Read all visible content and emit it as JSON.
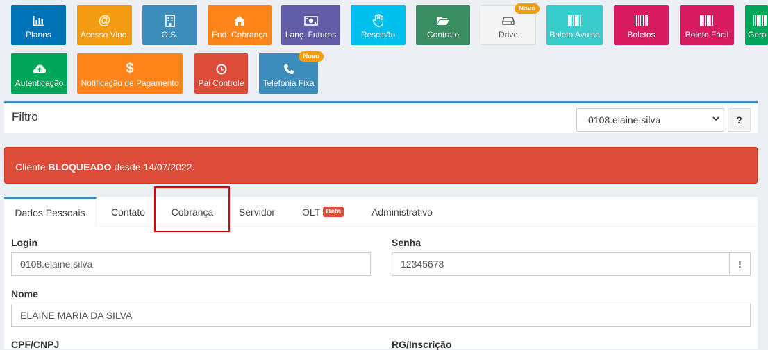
{
  "toolbar": {
    "planos": "Planos",
    "acesso_vinc": "Acesso Vinc.",
    "os": "O.S.",
    "end_cobranca": "End. Cobrança",
    "lanc_futuros": "Lanç. Futuros",
    "rescisao": "Rescisão",
    "contrato": "Contrato",
    "drive": "Drive",
    "boleto_avulso": "Boleto Avulso",
    "boletos": "Boletos",
    "boleto_facil": "Boleto Fácil",
    "gera": "Gera",
    "autenticacao": "Autenticação",
    "notificacao": "Notificação de Pagamento",
    "pai_controle": "Pai Controle",
    "telefonia_fixa": "Telefonia Fixa",
    "novo_badge": "Novo"
  },
  "colors": {
    "planos": "#0073b7",
    "acesso_vinc": "#f39c12",
    "os": "#3c8dbc",
    "end_cobranca": "#ff851b",
    "lanc_futuros": "#605ca8",
    "rescisao": "#00c0ef",
    "contrato": "#398d61",
    "drive": "#f4f4f4",
    "boleto_avulso": "#39cccc",
    "boletos": "#d81b60",
    "boleto_facil": "#d81b60",
    "gera": "#00a65a",
    "autenticacao": "#00a65a",
    "notificacao": "#ff851b",
    "pai_controle": "#dd4b39",
    "telefonia_fixa": "#3c8dbc",
    "alert": "#dd4b39",
    "accent": "#3c8dbc"
  },
  "icons": {
    "planos": "bar-chart-icon",
    "acesso_vinc": "at-icon",
    "os": "building-icon",
    "end_cobranca": "home-icon",
    "lanc_futuros": "money-icon",
    "rescisao": "hand-icon",
    "contrato": "folder-open-icon",
    "drive": "hard-drive-icon",
    "boleto": "barcode-icon",
    "autenticacao": "cloud-upload-icon",
    "notificacao": "dollar-icon",
    "pai_controle": "clock-icon",
    "telefonia_fixa": "phone-icon"
  },
  "filter": {
    "title": "Filtro",
    "selected": "0108.elaine.silva",
    "help": "?"
  },
  "alert": {
    "prefix": "Cliente ",
    "status": "BLOQUEADO",
    "suffix": " desde 14/07/2022."
  },
  "tabs": {
    "dados_pessoais": "Dados Pessoais",
    "contato": "Contato",
    "cobranca": "Cobrança",
    "servidor": "Servidor",
    "olt": "OLT",
    "beta": "Beta",
    "administrativo": "Administrativo"
  },
  "form": {
    "login_label": "Login",
    "login_value": "0108.elaine.silva",
    "senha_label": "Senha",
    "senha_value": "12345678",
    "senha_addon": "!",
    "nome_label": "Nome",
    "nome_value": "ELAINE MARIA DA SILVA",
    "cpf_label": "CPF/CNPJ",
    "rg_label": "RG/Inscrição"
  }
}
